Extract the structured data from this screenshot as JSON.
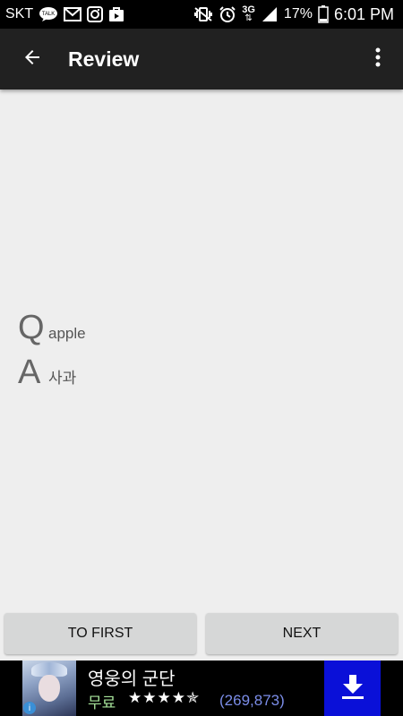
{
  "status_bar": {
    "carrier": "SKT",
    "network": "3G",
    "battery": "17%",
    "time": "6:01 PM",
    "icons": [
      "talk-icon",
      "gmail-icon",
      "instagram-icon",
      "play-store-icon",
      "vibrate-icon",
      "alarm-icon",
      "network-3g-icon",
      "signal-icon",
      "battery-icon"
    ]
  },
  "app_bar": {
    "title": "Review",
    "back_icon": "arrow-back-icon",
    "menu_icon": "more-vert-icon"
  },
  "card": {
    "question_letter": "Q",
    "question": "apple",
    "answer_letter": "A",
    "answer": "사과"
  },
  "buttons": {
    "first_label": "TO FIRST",
    "next_label": "NEXT"
  },
  "ad": {
    "title": "영웅의 군단",
    "price": "무료",
    "stars": "★★★★✯",
    "rating": 4.5,
    "count": "(269,873)",
    "download_icon": "download-icon",
    "colors": {
      "download_bg": "#0a10d8",
      "price": "#a6e29a",
      "count": "#7b8de8"
    }
  }
}
